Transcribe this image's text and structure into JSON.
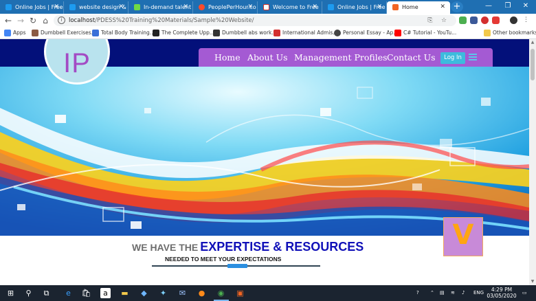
{
  "browser": {
    "tabs": [
      {
        "title": "Online Jobs | Free",
        "favicon": "#1d9bf0"
      },
      {
        "title": "website design &",
        "favicon": "#1d9bf0"
      },
      {
        "title": "In-demand talent",
        "favicon": "#6fda44"
      },
      {
        "title": "PeoplePerHour.co",
        "favicon": "#ff4b2b"
      },
      {
        "title": "Welcome to Free",
        "favicon": "#d93025"
      },
      {
        "title": "Online Jobs | Free",
        "favicon": "#1d9bf0"
      },
      {
        "title": "Home",
        "favicon": "#f26522"
      }
    ],
    "new_tab_glyph": "+",
    "window_controls": {
      "minimize": "—",
      "maximize": "❐",
      "close": "✕"
    },
    "url": {
      "host": "localhost",
      "path": "/PDESS%20Training%20Materials/Sample%20Website/"
    },
    "bookmarks": [
      {
        "label": "Apps",
        "color": "#4285f4"
      },
      {
        "label": "Dumbbell Exercises...",
        "color": "#8a5a44"
      },
      {
        "label": "Total Body Training...",
        "color": "#3a6fd8"
      },
      {
        "label": "The Complete Upp...",
        "color": "#222222"
      },
      {
        "label": "Dumbbell abs work...",
        "color": "#333333"
      },
      {
        "label": "International Admis...",
        "color": "#d32f2f"
      },
      {
        "label": "Personal Essay - Ap...",
        "color": "#444444"
      },
      {
        "label": "C# Tutorial - YouTu...",
        "color": "#ff0000"
      },
      {
        "label": "Other bookmarks",
        "color": "#f2c94c"
      }
    ]
  },
  "site": {
    "logo_text": "IP",
    "nav": [
      "Home",
      "About Us",
      "Management Profiles",
      "Contact Us"
    ],
    "login_label": "Log In",
    "badge_text": "V",
    "expertise": {
      "lead": "WE HAVE THE",
      "strong": "EXPERTISE & RESOURCES",
      "sub": "NEEDED TO MEET YOUR EXPECTATIONS"
    },
    "colors": {
      "header": "#03107a",
      "nav": "#a45ad3",
      "login": "#3dbbdd",
      "title_blue": "#1010b8"
    }
  },
  "taskbar": {
    "language": "ENG",
    "time": "4:29 PM",
    "date": "03/05/2020"
  }
}
